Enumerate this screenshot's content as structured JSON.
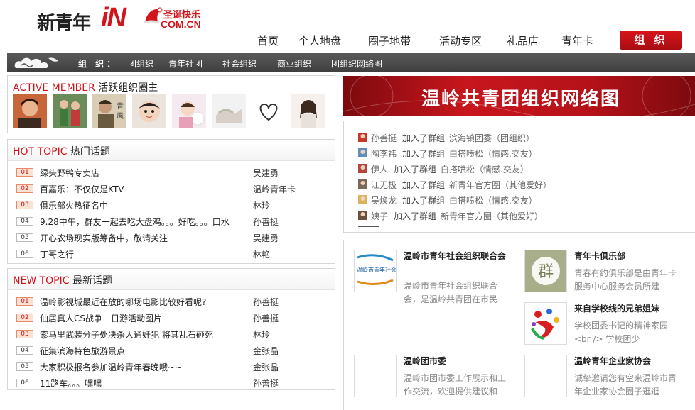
{
  "logo": {
    "cn": "新青年",
    "in": "iN",
    "xmas": "圣诞快乐",
    "com": "COM.CN"
  },
  "nav": {
    "items": [
      "首页",
      "个人地盘",
      "圈子地带",
      "活动专区",
      "礼品店",
      "青年卡"
    ],
    "org_button": "组 织"
  },
  "subnav": {
    "label": "组 织：",
    "items": [
      "团组织",
      "青年社团",
      "社会组织",
      "商业组织",
      "团组织网络图"
    ]
  },
  "active": {
    "title_en": "ACTIVE MEMBER",
    "title_zh": "活跃组织圈主",
    "avatars": [
      "avatar-1",
      "avatar-2",
      "avatar-3",
      "avatar-4",
      "avatar-5",
      "avatar-6",
      "avatar-7",
      "avatar-8"
    ]
  },
  "hot": {
    "title_en": "HOT TOPIC",
    "title_zh": "热门话题",
    "rows": [
      {
        "num": "01",
        "title": "绿头野鸭专卖店",
        "user": "吴建勇"
      },
      {
        "num": "02",
        "title": "百嘉乐：不仅仅是KTV",
        "user": "温岭青年卡"
      },
      {
        "num": "03",
        "title": "俱乐部火热征名中",
        "user": "林玲"
      },
      {
        "num": "04",
        "title": "9.28中午，群友一起去吃大盘鸡。。。好吃。。。口水",
        "user": "孙善挺"
      },
      {
        "num": "05",
        "title": "开心农场现实版筹备中，敬请关注",
        "user": "吴建勇"
      },
      {
        "num": "06",
        "title": "丁哥之行",
        "user": "林艳"
      }
    ]
  },
  "new": {
    "title_en": "NEW TOPIC",
    "title_zh": "最新话题",
    "rows": [
      {
        "num": "01",
        "title": "温岭影视城最近在放的哪场电影比较好看呢?",
        "user": "孙善挺"
      },
      {
        "num": "02",
        "title": "仙居真人CS战争一日游活动图片",
        "user": "孙善挺"
      },
      {
        "num": "03",
        "title": "索马里武装分子处决杀人通奸犯 将其乱石砸死",
        "user": "林玲"
      },
      {
        "num": "04",
        "title": "征集滨海特色旅游景点",
        "user": "金张晶"
      },
      {
        "num": "05",
        "title": "大家积极报名参加温岭青年春晚哦~~",
        "user": "金张晶"
      },
      {
        "num": "06",
        "title": "11路车。。。嘿嘿",
        "user": "孙善挺"
      }
    ]
  },
  "banner": {
    "title": "温岭共青团组织网络图"
  },
  "feed": [
    {
      "name": "孙善挺",
      "action": "加入了群组",
      "group": "滨海镇团委（团组织）",
      "color": "#c0392b"
    },
    {
      "name": "陶李祎",
      "action": "加入了群组",
      "group": "白搭喷松（情感.交友）",
      "color": "#5d8fb8"
    },
    {
      "name": "伊人",
      "action": "加入了群组",
      "group": "白搭喷松（情感.交友）",
      "color": "#b0463c"
    },
    {
      "name": "江无极",
      "action": "加入了群组",
      "group": "新青年官方圈（其他爱好）",
      "color": "#7a6a5a"
    },
    {
      "name": "吴焕龙",
      "action": "加入了群组",
      "group": "白搭喷松（情感.交友）",
      "color": "#d9b25a"
    },
    {
      "name": "姨子",
      "action": "加入了群组",
      "group": "新青年官方圈（其他爱好）",
      "color": "#6b5040"
    }
  ],
  "orgs": [
    {
      "name": "温岭市青年社会组织联合会",
      "desc": "温岭市青年社会组织联合会，是温岭共青团在市民",
      "pic": "youth-social-org-logo",
      "pic_text": "温岭市青年社会组织联合会"
    },
    {
      "name": "青年卡俱乐部",
      "desc": "青春有约俱乐部是由青年卡服务中心服务会员所建",
      "pic": "youth-card-club-logo",
      "pic_text": "群"
    },
    {
      "name": "来自学校线的兄弟姐妹",
      "desc": "学校团委书记的精神家园 <br /> 学校团少",
      "pic": "school-league-logo",
      "pic_text": ""
    },
    {
      "name": "温岭团市委",
      "desc": "温岭市团市委工作展示和工作交流，欢迎提供建议和",
      "pic": "league-committee-placeholder",
      "pic_text": ""
    },
    {
      "name": "温岭青年企业家协会",
      "desc": "诚挚邀请您有空来温岭市青年企业家协会圈子逛逛",
      "pic": "entrepreneur-placeholder",
      "pic_text": ""
    }
  ]
}
